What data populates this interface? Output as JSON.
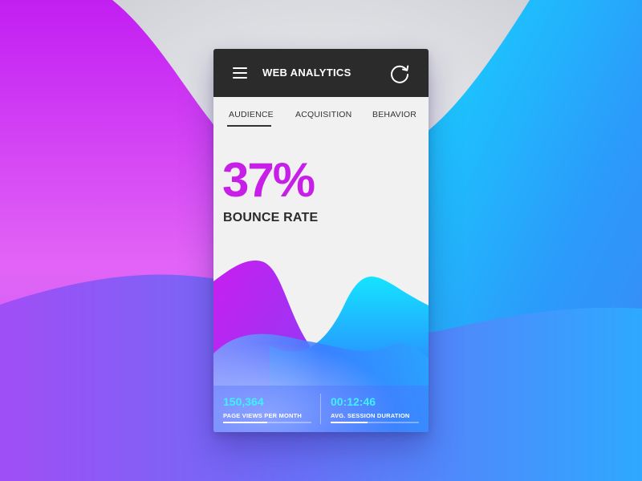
{
  "app": {
    "title": "WEB ANALYTICS"
  },
  "tabs": [
    {
      "label": "AUDIENCE",
      "active": true
    },
    {
      "label": "ACQUISITION",
      "active": false
    },
    {
      "label": "BEHAVIOR",
      "active": false
    }
  ],
  "metric": {
    "value": "37%",
    "label": "BOUNCE RATE"
  },
  "stats": [
    {
      "value": "150,364",
      "label": "PAGE VIEWS PER MONTH",
      "progress": 0.5
    },
    {
      "value": "00:12:46",
      "label": "AVG. SESSION DURATION",
      "progress": 0.42
    }
  ],
  "icons": {
    "menu": "hamburger-icon",
    "refresh": "refresh-icon"
  },
  "colors": {
    "magenta": "#c71fe8",
    "cyan": "#3ff0ff",
    "blue": "#2d7bff",
    "appbar": "#2b2b2b"
  }
}
